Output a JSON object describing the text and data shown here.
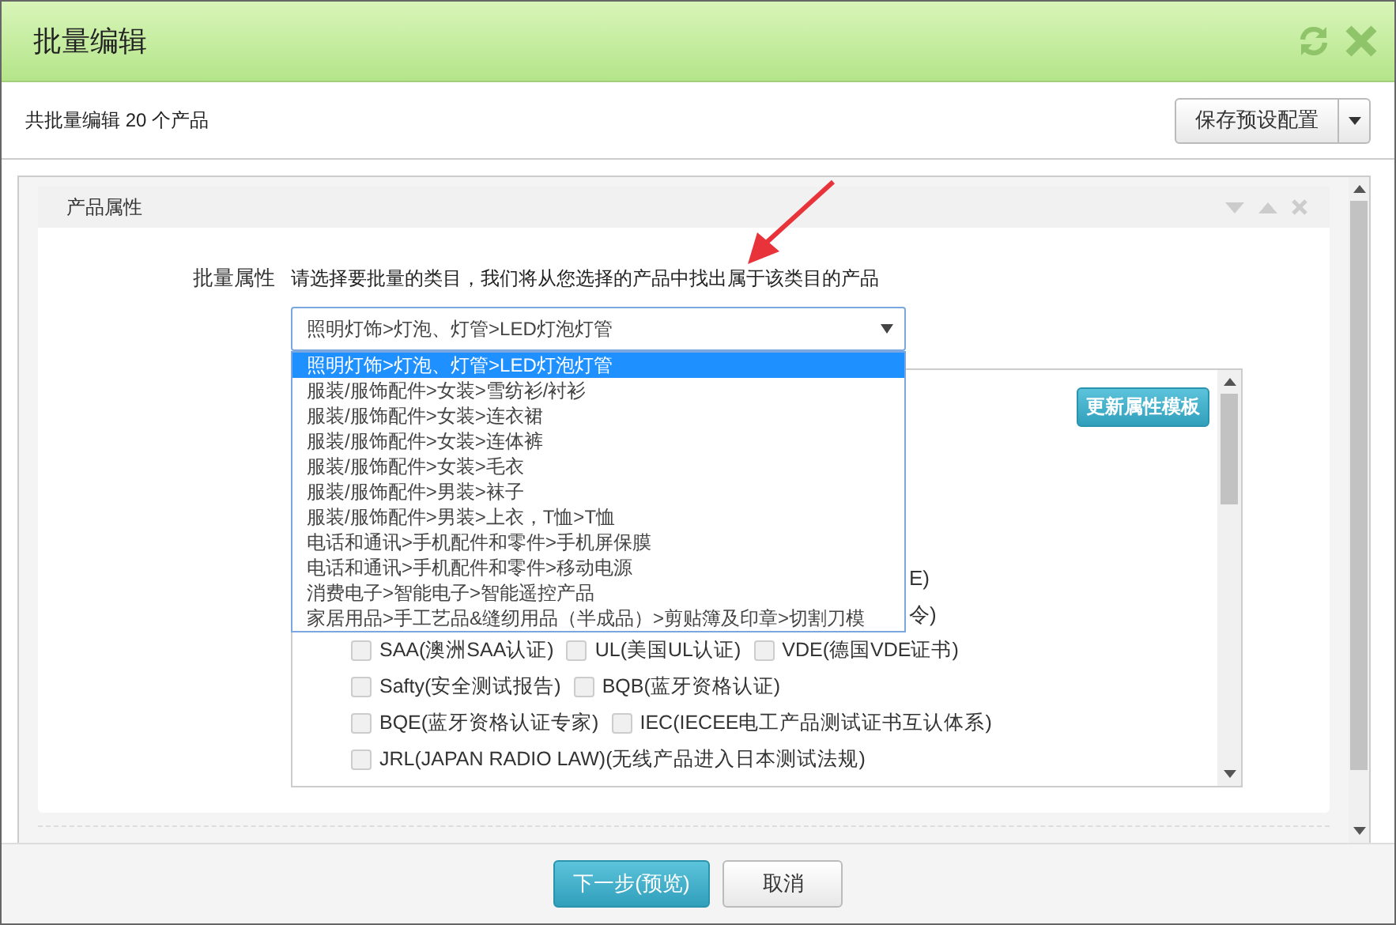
{
  "window": {
    "title": "批量编辑"
  },
  "toolbar": {
    "summary": "共批量编辑 20 个产品",
    "save_button": "保存预设配置"
  },
  "panel": {
    "title": "产品属性",
    "field_label": "批量属性",
    "hint": "请选择要批量的类目，我们将从您选择的产品中找出属于该类目的产品",
    "category_select": {
      "value": "照明灯饰>灯泡、灯管>LED灯泡灯管",
      "expanded": true,
      "options": [
        {
          "label": "照明灯饰>灯泡、灯管>LED灯泡灯管",
          "selected": true
        },
        {
          "label": "服装/服饰配件>女装>雪纺衫/衬衫",
          "selected": false
        },
        {
          "label": "服装/服饰配件>女装>连衣裙",
          "selected": false
        },
        {
          "label": "服装/服饰配件>女装>连体裤",
          "selected": false
        },
        {
          "label": "服装/服饰配件>女装>毛衣",
          "selected": false
        },
        {
          "label": "服装/服饰配件>男装>袜子",
          "selected": false
        },
        {
          "label": "服装/服饰配件>男装>上衣，T恤>T恤",
          "selected": false
        },
        {
          "label": "电话和通讯>手机配件和零件>手机屏保膜",
          "selected": false
        },
        {
          "label": "电话和通讯>手机配件和零件>移动电源",
          "selected": false
        },
        {
          "label": "消费电子>智能电子>智能遥控产品",
          "selected": false
        },
        {
          "label": "家居用品>手工艺品&缝纫用品（半成品）>剪贴簿及印章>切割刀模",
          "selected": false
        }
      ]
    },
    "update_button": "更新属性模板",
    "covered_rows": [
      {
        "visible_text": "E)"
      },
      {
        "visible_text": "令)"
      }
    ],
    "certification_rows": [
      {
        "items": [
          {
            "label": "SAA(澳洲SAA认证)",
            "checked": false
          },
          {
            "label": "UL(美国UL认证)",
            "checked": false
          },
          {
            "label": "VDE(德国VDE证书)",
            "checked": false
          }
        ]
      },
      {
        "items": [
          {
            "label": "Safty(安全测试报告)",
            "checked": false
          },
          {
            "label": "BQB(蓝牙资格认证)",
            "checked": false
          }
        ]
      },
      {
        "items": [
          {
            "label": "BQE(蓝牙资格认证专家)",
            "checked": false
          },
          {
            "label": "IEC(IECEE电工产品测试证书互认体系)",
            "checked": false
          }
        ]
      },
      {
        "items": [
          {
            "label": "JRL(JAPAN RADIO LAW)(无线产品进入日本测试法规)",
            "checked": false
          }
        ]
      }
    ]
  },
  "footer": {
    "buttons": [
      {
        "label": "下一步(预览)",
        "kind": "primary"
      },
      {
        "label": "取消",
        "kind": "default"
      }
    ]
  }
}
